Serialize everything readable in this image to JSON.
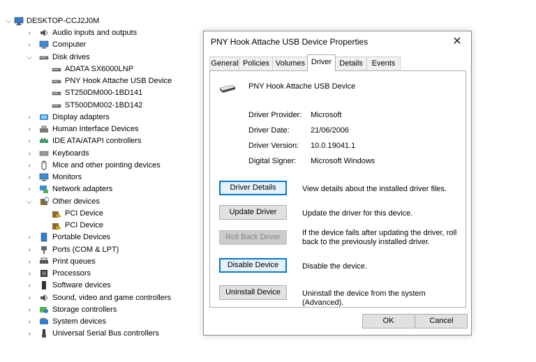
{
  "tree": {
    "computer": "DESKTOP-CCJ2J0M",
    "items": [
      {
        "label": "Audio inputs and outputs",
        "icon": "speaker-icon",
        "expanded": false
      },
      {
        "label": "Computer",
        "icon": "monitor-icon",
        "expanded": false
      },
      {
        "label": "Disk drives",
        "icon": "disk-drive-icon",
        "expanded": true,
        "children": [
          "ADATA SX6000LNP",
          "PNY Hook Attache USB Device",
          "ST250DM000-1BD141",
          "ST500DM002-1BD142"
        ]
      },
      {
        "label": "Display adapters",
        "icon": "display-adapter-icon",
        "expanded": false
      },
      {
        "label": "Human Interface Devices",
        "icon": "hid-icon",
        "expanded": false
      },
      {
        "label": "IDE ATA/ATAPI controllers",
        "icon": "ide-controller-icon",
        "expanded": false
      },
      {
        "label": "Keyboards",
        "icon": "keyboard-icon",
        "expanded": false
      },
      {
        "label": "Mice and other pointing devices",
        "icon": "mouse-icon",
        "expanded": false
      },
      {
        "label": "Monitors",
        "icon": "monitor-icon",
        "expanded": false
      },
      {
        "label": "Network adapters",
        "icon": "network-adapter-icon",
        "expanded": false
      },
      {
        "label": "Other devices",
        "icon": "unknown-device-icon",
        "expanded": true,
        "children": [
          "PCI Device",
          "PCI Device"
        ]
      },
      {
        "label": "Portable Devices",
        "icon": "portable-device-icon",
        "expanded": false
      },
      {
        "label": "Ports (COM & LPT)",
        "icon": "port-icon",
        "expanded": false
      },
      {
        "label": "Print queues",
        "icon": "printer-icon",
        "expanded": false
      },
      {
        "label": "Processors",
        "icon": "processor-icon",
        "expanded": false
      },
      {
        "label": "Software devices",
        "icon": "software-device-icon",
        "expanded": false
      },
      {
        "label": "Sound, video and game controllers",
        "icon": "speaker-icon",
        "expanded": false
      },
      {
        "label": "Storage controllers",
        "icon": "storage-controller-icon",
        "expanded": false
      },
      {
        "label": "System devices",
        "icon": "system-device-icon",
        "expanded": false
      },
      {
        "label": "Universal Serial Bus controllers",
        "icon": "usb-icon",
        "expanded": false
      }
    ]
  },
  "dialog": {
    "title": "PNY Hook Attache USB Device Properties",
    "tabs": [
      "General",
      "Policies",
      "Volumes",
      "Driver",
      "Details",
      "Events"
    ],
    "active_tab": "Driver",
    "device_name": "PNY Hook Attache USB Device",
    "fields": [
      {
        "label": "Driver Provider:",
        "value": "Microsoft"
      },
      {
        "label": "Driver Date:",
        "value": "21/06/2006"
      },
      {
        "label": "Driver Version:",
        "value": "10.0.19041.1"
      },
      {
        "label": "Digital Signer:",
        "value": "Microsoft Windows"
      }
    ],
    "actions": [
      {
        "label": "Driver Details",
        "desc": "View details about the installed driver files.",
        "state": "focused"
      },
      {
        "label": "Update Driver",
        "desc": "Update the driver for this device.",
        "state": "normal"
      },
      {
        "label": "Roll Back Driver",
        "desc": "If the device fails after updating the driver, roll back to the previously installed driver.",
        "state": "disabled"
      },
      {
        "label": "Disable Device",
        "desc": "Disable the device.",
        "state": "focused"
      },
      {
        "label": "Uninstall Device",
        "desc": "Uninstall the device from the system (Advanced).",
        "state": "normal"
      }
    ],
    "ok_label": "OK",
    "cancel_label": "Cancel",
    "close_glyph": "✕"
  },
  "colors": {
    "accent": "#0078d7",
    "border": "#adadad",
    "button": "#e1e1e1"
  }
}
